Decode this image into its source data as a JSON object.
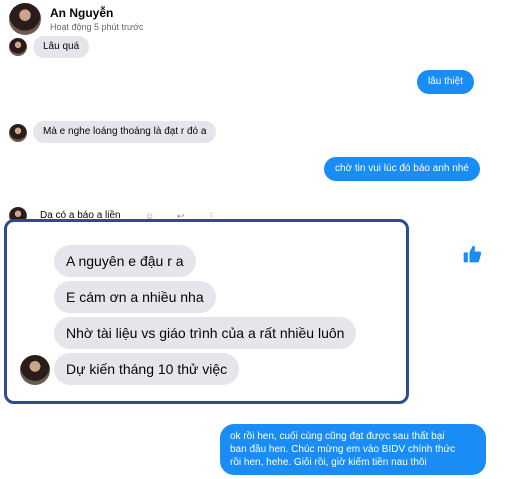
{
  "header": {
    "name": "An Nguyễn",
    "status": "Hoạt động 5 phút trước"
  },
  "messages_top": [
    {
      "from": "them",
      "text": "Lâu quá"
    },
    {
      "from": "me",
      "text": "lâu thiệt"
    },
    {
      "from": "them",
      "text": "Mà e nghe loáng thoáng là đạt r đó a"
    },
    {
      "from": "me",
      "text": "chờ tin vui lúc đó báo anh nhé"
    },
    {
      "from": "them",
      "text": "Dạ có a báo a liền"
    }
  ],
  "highlight_messages": [
    "A nguyên e đậu r a",
    "E cám ơn a nhiều nha",
    "Nhờ tài liệu vs giáo trình của a rất nhiều luôn",
    "Dự kiến tháng 10 thử việc"
  ],
  "reaction_icon": "thumbs-up-icon",
  "last_message_lines": [
    "ok rồi hen, cuối cùng cũng đạt được sau thất bại",
    "ban đầu hen. Chúc mừng em vào BIDV chính thức",
    "rồi hen, hehe. Giỏi rồi, giờ kiếm tiền nau thôi"
  ],
  "colors": {
    "outgoing": "#1a8cf5",
    "incoming": "#e4e6eb",
    "highlight_border": "#2f4a8f"
  }
}
